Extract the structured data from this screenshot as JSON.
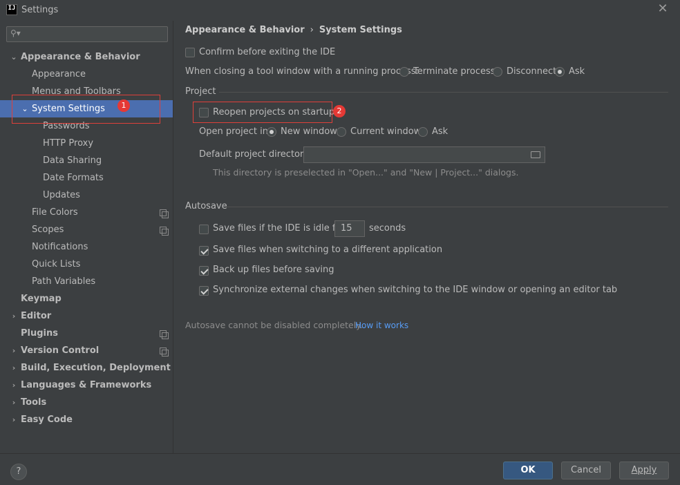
{
  "window": {
    "title": "Settings",
    "app_icon_text": "IJ",
    "close_glyph": "✕"
  },
  "search": {
    "placeholder": "",
    "icon": "search-icon"
  },
  "sidebar": {
    "items": [
      {
        "label": "Appearance & Behavior",
        "expanded": true
      },
      {
        "label": "Appearance"
      },
      {
        "label": "Menus and Toolbars"
      },
      {
        "label": "System Settings",
        "expanded": true,
        "selected": true
      },
      {
        "label": "Passwords"
      },
      {
        "label": "HTTP Proxy"
      },
      {
        "label": "Data Sharing"
      },
      {
        "label": "Date Formats"
      },
      {
        "label": "Updates"
      },
      {
        "label": "File Colors"
      },
      {
        "label": "Scopes"
      },
      {
        "label": "Notifications"
      },
      {
        "label": "Quick Lists"
      },
      {
        "label": "Path Variables"
      },
      {
        "label": "Keymap"
      },
      {
        "label": "Editor"
      },
      {
        "label": "Plugins"
      },
      {
        "label": "Version Control"
      },
      {
        "label": "Build, Execution, Deployment"
      },
      {
        "label": "Languages & Frameworks"
      },
      {
        "label": "Tools"
      },
      {
        "label": "Easy Code"
      }
    ]
  },
  "breadcrumb": {
    "parent": "Appearance & Behavior",
    "separator": "›",
    "current": "System Settings"
  },
  "general": {
    "confirm_exit": {
      "label": "Confirm before exiting the IDE",
      "checked": false
    },
    "closing_tool_window": {
      "label": "When closing a tool window with a running process:",
      "options": [
        "Terminate process",
        "Disconnect",
        "Ask"
      ],
      "selected": "Ask"
    }
  },
  "project": {
    "group_title": "Project",
    "reopen": {
      "label": "Reopen projects on startup",
      "checked": false
    },
    "open_in": {
      "label": "Open project in",
      "options": [
        "New window",
        "Current window",
        "Ask"
      ],
      "selected": "New window"
    },
    "default_dir": {
      "label": "Default project directory:",
      "value": "",
      "hint": "This directory is preselected in \"Open...\" and \"New | Project...\" dialogs."
    }
  },
  "autosave": {
    "group_title": "Autosave",
    "idle": {
      "label": "Save files if the IDE is idle for",
      "checked": false,
      "value": "15",
      "unit": "seconds"
    },
    "switch_app": {
      "label": "Save files when switching to a different application",
      "checked": true
    },
    "backup": {
      "label": "Back up files before saving",
      "checked": true
    },
    "sync": {
      "label": "Synchronize external changes when switching to the IDE window or opening an editor tab",
      "checked": true
    },
    "note": "Autosave cannot be disabled completely.",
    "link": "How it works"
  },
  "annotations": {
    "badge1": "1",
    "badge2": "2"
  },
  "buttons": {
    "help": "?",
    "ok": "OK",
    "cancel": "Cancel",
    "apply": "Apply"
  },
  "colors": {
    "accent": "#4b6eaf",
    "primary_button": "#365880",
    "link": "#589df6",
    "marker": "#e53935"
  }
}
